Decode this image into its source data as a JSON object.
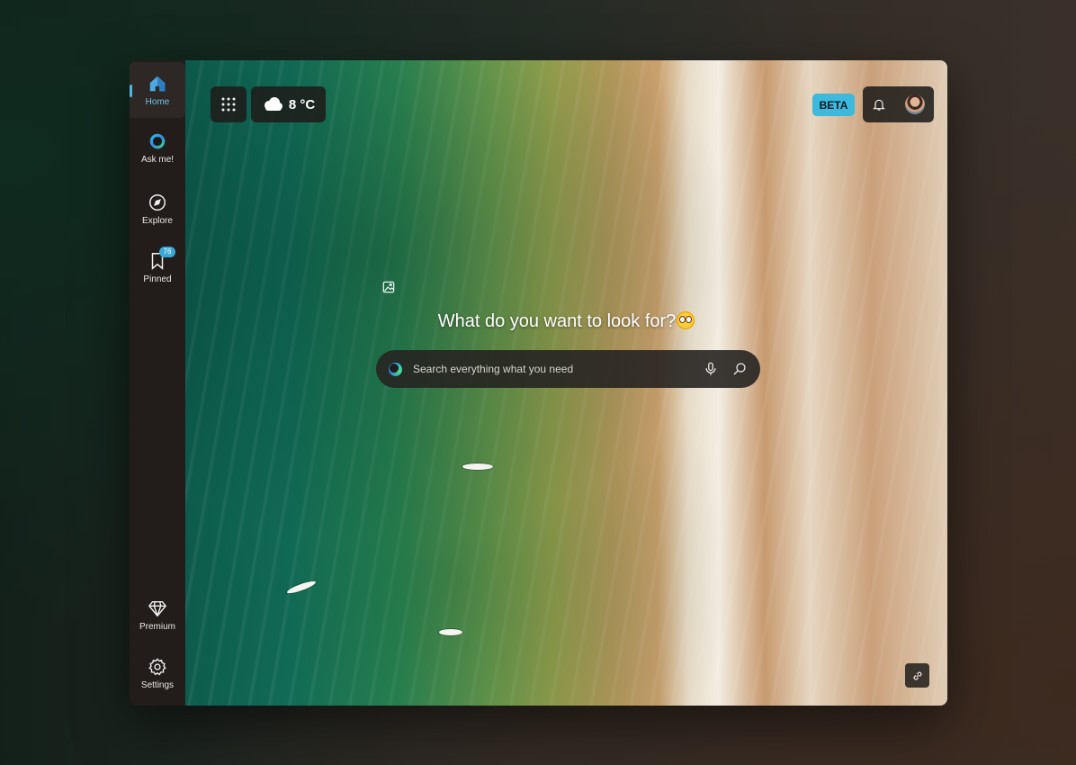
{
  "sidebar": {
    "items": [
      {
        "label": "Home",
        "icon": "home-icon",
        "active": true
      },
      {
        "label": "Ask me!",
        "icon": "ask-orb-icon"
      },
      {
        "label": "Explore",
        "icon": "compass-icon"
      },
      {
        "label": "Pinned",
        "icon": "bookmark-icon",
        "badge": "76"
      }
    ],
    "bottom_items": [
      {
        "label": "Premium",
        "icon": "diamond-icon"
      },
      {
        "label": "Settings",
        "icon": "gear-icon"
      }
    ]
  },
  "header": {
    "apps_icon": "grid-icon",
    "weather": {
      "icon": "cloud-icon",
      "temperature": "8 °C"
    },
    "beta_label": "BETA",
    "notification_icon": "bell-icon",
    "avatar": "user-avatar"
  },
  "main": {
    "prompt": "What do you want to look for?",
    "prompt_emoji": "flushed-emoji",
    "search": {
      "placeholder": "Search everything what you need",
      "mic_icon": "microphone-icon",
      "search_icon": "search-icon"
    },
    "background_icon": "image-icon",
    "link_icon": "link-icon"
  },
  "colors": {
    "accent": "#3cb9dc",
    "sidebar_bg": "#221d1b",
    "tile_bg": "#1e1c1a"
  }
}
